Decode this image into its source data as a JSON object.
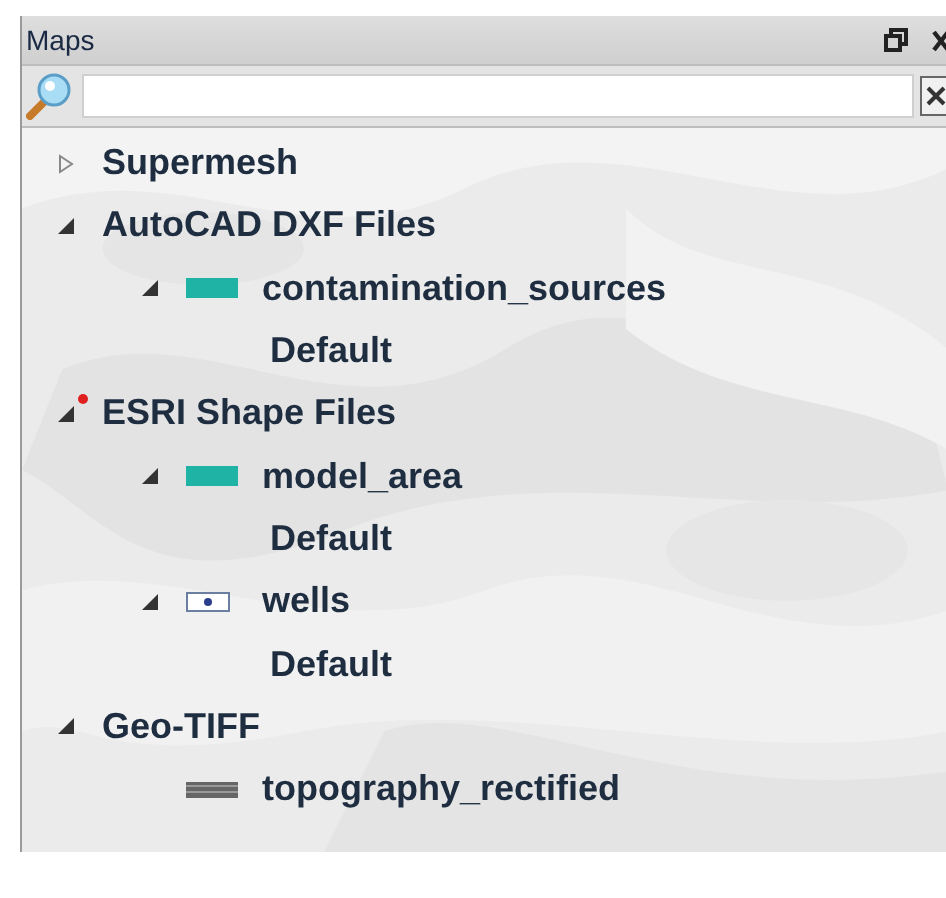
{
  "panel": {
    "title": "Maps"
  },
  "tree": [
    {
      "label": "Supermesh",
      "expanded": false
    },
    {
      "label": "AutoCAD DXF Files",
      "expanded": true,
      "children": [
        {
          "label": "contamination_sources",
          "expanded": true,
          "kind": "polygon",
          "children": [
            {
              "label": "Default"
            }
          ]
        }
      ]
    },
    {
      "label": "ESRI Shape Files",
      "expanded": true,
      "flagged": true,
      "children": [
        {
          "label": "model_area",
          "expanded": true,
          "kind": "polygon",
          "children": [
            {
              "label": "Default"
            }
          ]
        },
        {
          "label": "wells",
          "expanded": true,
          "kind": "point",
          "children": [
            {
              "label": "Default"
            }
          ]
        }
      ]
    },
    {
      "label": "Geo-TIFF",
      "expanded": true,
      "children": [
        {
          "label": "topography_rectified",
          "kind": "raster"
        }
      ]
    }
  ]
}
